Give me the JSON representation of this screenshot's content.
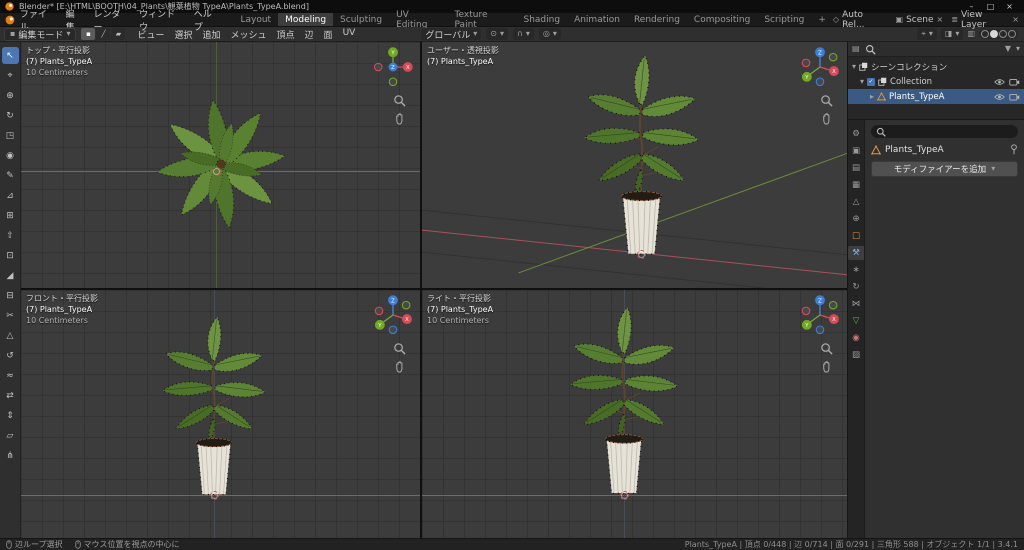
{
  "titlebar": {
    "title": "Blender* [E:\\HTML\\BOOTH\\04_Plants\\観葉植物 TypeA\\Plants_TypeA.blend]",
    "minimize": "–",
    "maximize": "□",
    "close": "×"
  },
  "menubar": {
    "menus": [
      "ファイル",
      "編集",
      "レンダー",
      "ウィンドウ",
      "ヘルプ"
    ],
    "workspaces": [
      "Layout",
      "Modeling",
      "Sculpting",
      "UV Editing",
      "Texture Paint",
      "Shading",
      "Animation",
      "Rendering",
      "Compositing",
      "Scripting"
    ],
    "add_workspace": "+",
    "auto_rel": "Auto Rel...",
    "scene": "Scene",
    "view_layer": "View Layer"
  },
  "tool_header": {
    "mode": "編集モード",
    "menus": [
      "ビュー",
      "選択",
      "追加",
      "メッシュ",
      "頂点",
      "辺",
      "面",
      "UV"
    ],
    "orientation": "グローバル",
    "select_modes": [
      {
        "name": "vertex",
        "glyph": "▪"
      },
      {
        "name": "edge",
        "glyph": "╱"
      },
      {
        "name": "face",
        "glyph": "▰"
      }
    ]
  },
  "toolbar_tools": [
    {
      "name": "select-box",
      "glyph": "↖"
    },
    {
      "name": "cursor",
      "glyph": "⌖"
    },
    {
      "name": "move",
      "glyph": "⊕"
    },
    {
      "name": "rotate",
      "glyph": "↻"
    },
    {
      "name": "scale",
      "glyph": "◳"
    },
    {
      "name": "transform",
      "glyph": "◉"
    },
    {
      "name": "annotate",
      "glyph": "✎"
    },
    {
      "name": "measure",
      "glyph": "⊿"
    },
    {
      "name": "add-cube",
      "glyph": "⊞"
    },
    {
      "name": "extrude",
      "glyph": "⇧"
    },
    {
      "name": "inset-faces",
      "glyph": "⊡"
    },
    {
      "name": "bevel",
      "glyph": "◢"
    },
    {
      "name": "loop-cut",
      "glyph": "⊟"
    },
    {
      "name": "knife",
      "glyph": "✂"
    },
    {
      "name": "poly-build",
      "glyph": "△"
    },
    {
      "name": "spin",
      "glyph": "↺"
    },
    {
      "name": "smooth",
      "glyph": "≈"
    },
    {
      "name": "edge-slide",
      "glyph": "⇄"
    },
    {
      "name": "shrink-fatten",
      "glyph": "⇕"
    },
    {
      "name": "shear",
      "glyph": "▱"
    },
    {
      "name": "rip-region",
      "glyph": "⋔"
    }
  ],
  "viewports": {
    "top": {
      "view": "トップ・平行投影",
      "object": "(7) Plants_TypeA",
      "scale": "10 Centimeters"
    },
    "user": {
      "view": "ユーザー・透視投影",
      "object": "(7) Plants_TypeA"
    },
    "front": {
      "view": "フロント・平行投影",
      "object": "(7) Plants_TypeA",
      "scale": "10 Centimeters"
    },
    "right": {
      "view": "ライト・平行投影",
      "object": "(7) Plants_TypeA",
      "scale": "10 Centimeters"
    }
  },
  "outliner": {
    "scene_collection": "シーンコレクション",
    "collection": "Collection",
    "object": "Plants_TypeA"
  },
  "properties": {
    "object_name": "Plants_TypeA",
    "add_modifier": "モディファイアーを追加"
  },
  "props_tabs": [
    {
      "name": "tool",
      "glyph": "⚙"
    },
    {
      "name": "render",
      "glyph": "▣"
    },
    {
      "name": "output",
      "glyph": "▤"
    },
    {
      "name": "view-layer",
      "glyph": "▦"
    },
    {
      "name": "scene",
      "glyph": "△"
    },
    {
      "name": "world",
      "glyph": "⊕"
    },
    {
      "name": "object",
      "glyph": "□"
    },
    {
      "name": "modifiers",
      "glyph": "⚒"
    },
    {
      "name": "particles",
      "glyph": "∗"
    },
    {
      "name": "physics",
      "glyph": "↻"
    },
    {
      "name": "constraints",
      "glyph": "⋈"
    },
    {
      "name": "object-data",
      "glyph": "▽"
    },
    {
      "name": "material",
      "glyph": "◉"
    },
    {
      "name": "texture",
      "glyph": "▨"
    }
  ],
  "icons": {
    "dropdown": "▾",
    "pivot": "⊙",
    "magnet": "∩",
    "proportional": "◎",
    "gizmo_toggle": "⌖",
    "overlays": "◨",
    "xray": "▥",
    "auto_rel": "◇",
    "scene": "▣",
    "view_layer": "≣",
    "close_x": "×",
    "check": "✓",
    "disclosure_open": "▾",
    "disclosure_closed": "▸",
    "funnel": "▼",
    "editor_outliner": "▤",
    "editor_3d": "▦"
  },
  "gizmo_axes": {
    "x": "X",
    "y": "Y",
    "z": "Z"
  },
  "statusbar": {
    "hint1": "辺ループ選択",
    "hint2": "マウス位置を視点の中心に",
    "stats": "Plants_TypeA | 頂点 0/448 | 辺 0/714 | 面 0/291 | 三角形 588 | オブジェクト 1/1 | 3.4.1"
  },
  "colors": {
    "accent": "#4772b3",
    "axis_x": "#d84b56",
    "axis_y": "#71a824",
    "axis_z": "#3b7fd8",
    "selection": "#3a5a84",
    "object_orange": "#e2953f",
    "mesh_green": "#57c057",
    "viewport_bg": "#3c3c3c"
  }
}
